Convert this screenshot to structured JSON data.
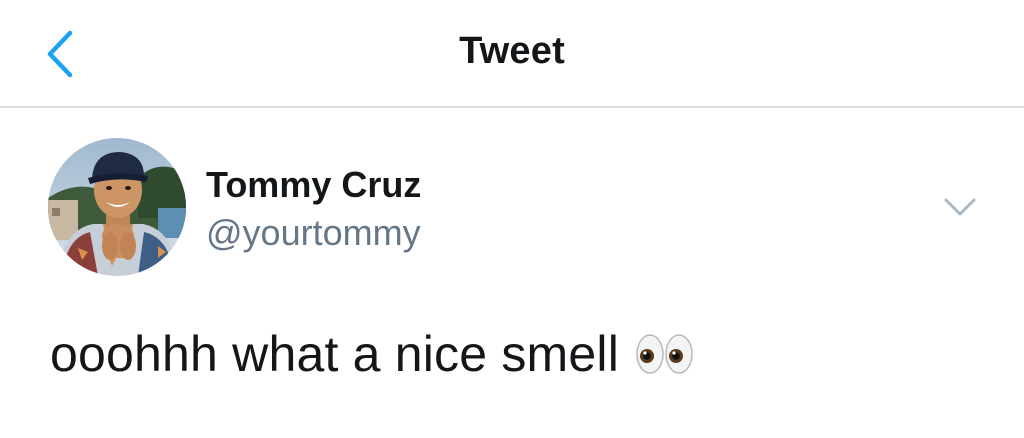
{
  "navbar": {
    "title": "Tweet",
    "back_icon": "chevron-left-icon",
    "accent_color": "#1da1f2"
  },
  "tweet": {
    "author": {
      "display_name": "Tommy Cruz",
      "handle": "@yourtommy",
      "avatar_icon": "profile-photo"
    },
    "text": "ooohhh what a nice smell",
    "emoji": "eyes-emoji",
    "more_icon": "chevron-down-icon"
  },
  "colors": {
    "primary_text": "#14171a",
    "secondary_text": "#657786",
    "divider": "#d9dde1",
    "background": "#ffffff"
  }
}
